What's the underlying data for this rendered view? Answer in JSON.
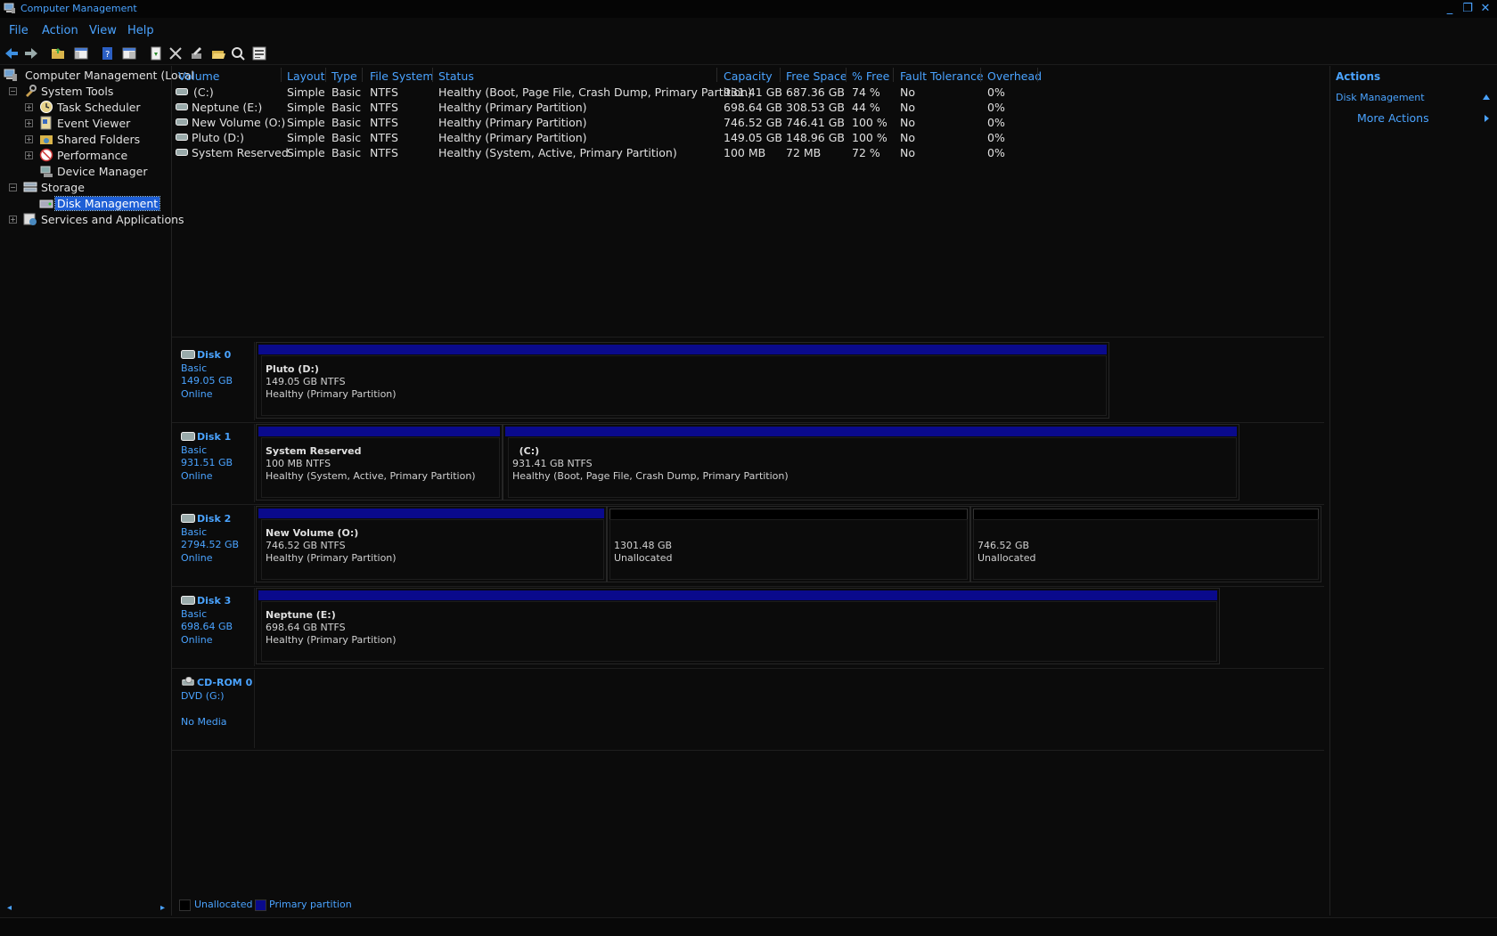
{
  "window": {
    "title": "Computer Management",
    "minimize": "_",
    "restore": "❐",
    "close": "✕"
  },
  "menu": [
    "File",
    "Action",
    "View",
    "Help"
  ],
  "tree": {
    "root": "Computer Management (Local",
    "system_tools": "System Tools",
    "task_scheduler": "Task Scheduler",
    "event_viewer": "Event Viewer",
    "shared_folders": "Shared Folders",
    "performance": "Performance",
    "device_manager": "Device Manager",
    "storage": "Storage",
    "disk_management": "Disk Management",
    "services": "Services and Applications"
  },
  "volumes": {
    "headers": [
      "Volume",
      "Layout",
      "Type",
      "File System",
      "Status",
      "Capacity",
      "Free Space",
      "% Free",
      "Fault Tolerance",
      "Overhead"
    ],
    "rows": [
      [
        "(C:)",
        "Simple",
        "Basic",
        "NTFS",
        "Healthy (Boot, Page File, Crash Dump, Primary Partition)",
        "931.41 GB",
        "687.36 GB",
        "74 %",
        "No",
        "0%"
      ],
      [
        "Neptune (E:)",
        "Simple",
        "Basic",
        "NTFS",
        "Healthy (Primary Partition)",
        "698.64 GB",
        "308.53 GB",
        "44 %",
        "No",
        "0%"
      ],
      [
        "New Volume (O:)",
        "Simple",
        "Basic",
        "NTFS",
        "Healthy (Primary Partition)",
        "746.52 GB",
        "746.41 GB",
        "100 %",
        "No",
        "0%"
      ],
      [
        "Pluto (D:)",
        "Simple",
        "Basic",
        "NTFS",
        "Healthy (Primary Partition)",
        "149.05 GB",
        "148.96 GB",
        "100 %",
        "No",
        "0%"
      ],
      [
        "System Reserved",
        "Simple",
        "Basic",
        "NTFS",
        "Healthy (System, Active, Primary Partition)",
        "100 MB",
        "72 MB",
        "72 %",
        "No",
        "0%"
      ]
    ]
  },
  "disks": [
    {
      "name": "Disk 0",
      "type": "Basic",
      "size": "149.05 GB",
      "status": "Online",
      "partitions": [
        {
          "name": "Pluto  (D:)",
          "size": "149.05 GB NTFS",
          "status": "Healthy (Primary Partition)",
          "kind": "primary"
        }
      ]
    },
    {
      "name": "Disk 1",
      "type": "Basic",
      "size": "931.51 GB",
      "status": "Online",
      "partitions": [
        {
          "name": "System Reserved",
          "size": "100 MB NTFS",
          "status": "Healthy (System, Active, Primary Partition)",
          "kind": "primary"
        },
        {
          "name": "  (C:)",
          "size": "931.41 GB NTFS",
          "status": "Healthy (Boot, Page File, Crash Dump, Primary Partition)",
          "kind": "primary"
        }
      ]
    },
    {
      "name": "Disk 2",
      "type": "Basic",
      "size": "2794.52 GB",
      "status": "Online",
      "partitions": [
        {
          "name": "New Volume  (O:)",
          "size": "746.52 GB NTFS",
          "status": "Healthy (Primary Partition)",
          "kind": "primary"
        },
        {
          "name": "",
          "size": "1301.48 GB",
          "status": "Unallocated",
          "kind": "unallocated"
        },
        {
          "name": "",
          "size": "746.52 GB",
          "status": "Unallocated",
          "kind": "unallocated"
        }
      ]
    },
    {
      "name": "Disk 3",
      "type": "Basic",
      "size": "698.64 GB",
      "status": "Online",
      "partitions": [
        {
          "name": "Neptune  (E:)",
          "size": "698.64 GB NTFS",
          "status": "Healthy (Primary Partition)",
          "kind": "primary"
        }
      ]
    }
  ],
  "cdrom": {
    "name": "CD-ROM 0",
    "drive": "DVD (G:)",
    "status": "No Media"
  },
  "legend": {
    "unallocated": "Unallocated",
    "primary": "Primary partition"
  },
  "actions": {
    "title": "Actions",
    "section": "Disk Management",
    "more": "More Actions"
  },
  "colors": {
    "accent": "#4aa3ff",
    "primary_partition": "#0a0a8c",
    "unallocated": "#000000",
    "selection": "#1e5fd6"
  }
}
